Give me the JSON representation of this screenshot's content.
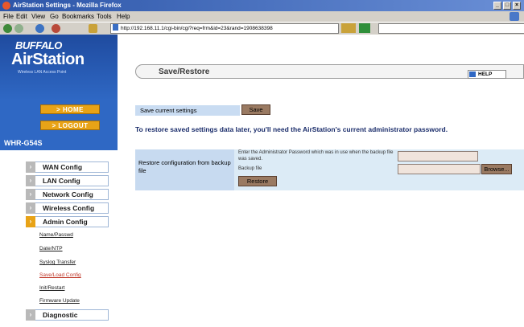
{
  "window": {
    "title": "AirStation Settings - Mozilla Firefox"
  },
  "menubar": {
    "items": [
      "File",
      "Edit",
      "View",
      "Go",
      "Bookmarks",
      "Tools",
      "Help"
    ]
  },
  "toolbar": {
    "url": "http://192.168.11.1/cgi-bin/cgi?req=frm&id=23&rand=1908638398"
  },
  "sidebar": {
    "brand": "BUFFALO",
    "product": "AirStation",
    "tagline": "Wireless LAN Access Point",
    "home_label": "HOME",
    "logout_label": "LOGOUT",
    "model": "WHR-G54S",
    "menu": [
      {
        "label": "WAN Config"
      },
      {
        "label": "LAN Config"
      },
      {
        "label": "Network Config"
      },
      {
        "label": "Wireless Config"
      },
      {
        "label": "Admin Config"
      }
    ],
    "submenu": [
      {
        "label": "Name/Passwd"
      },
      {
        "label": "Date/NTP"
      },
      {
        "label": "Syslog Transfer"
      },
      {
        "label": "Save/Load Config"
      },
      {
        "label": "Init/Restart"
      },
      {
        "label": "Firmware Update"
      }
    ],
    "diagnostic_label": "Diagnostic"
  },
  "main": {
    "title": "Save/Restore",
    "help_label": "HELP",
    "save_current_label": "Save current settings",
    "save_button": "Save",
    "notice": "To restore saved settings data later, you'll need the AirStation's current administrator password.",
    "restore_label": "Restore configuration from backup file",
    "password_note": "Enter the Administrator Password which was in use when the backup file was saved.",
    "backup_file_label": "Backup file",
    "browse_button": "Browse...",
    "restore_button": "Restore"
  }
}
